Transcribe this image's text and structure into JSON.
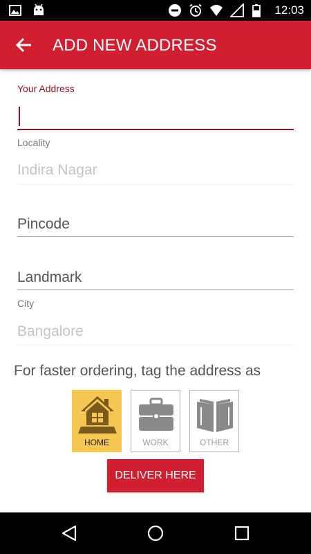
{
  "status_bar": {
    "time": "12:03",
    "left_icons": [
      "image-icon",
      "android-icon"
    ],
    "right_icons": [
      "do-not-disturb-icon",
      "alarm-icon",
      "wifi-icon",
      "signal-icon",
      "battery-icon"
    ]
  },
  "app_bar": {
    "title": "ADD NEW ADDRESS",
    "back_icon": "arrow-back-icon",
    "background": "#d01f31"
  },
  "form": {
    "address": {
      "label": "Your Address",
      "value": ""
    },
    "locality": {
      "label": "Locality",
      "value": "Indira Nagar"
    },
    "pincode": {
      "placeholder": "Pincode"
    },
    "landmark": {
      "placeholder": "Landmark"
    },
    "city": {
      "label": "City",
      "value": "Bangalore"
    }
  },
  "tags": {
    "prompt": "For faster ordering, tag the address as",
    "options": [
      {
        "label": "HOME",
        "icon": "home-icon",
        "selected": true
      },
      {
        "label": "WORK",
        "icon": "briefcase-icon",
        "selected": false
      },
      {
        "label": "OTHER",
        "icon": "book-icon",
        "selected": false
      }
    ]
  },
  "deliver_button": {
    "label": "DELIVER HERE"
  },
  "nav_bar": {
    "buttons": [
      "back-triangle-icon",
      "home-circle-icon",
      "recents-square-icon"
    ]
  },
  "colors": {
    "accent": "#d01f31",
    "active_field": "#8b1822",
    "selected_tag": "#f7c751"
  }
}
